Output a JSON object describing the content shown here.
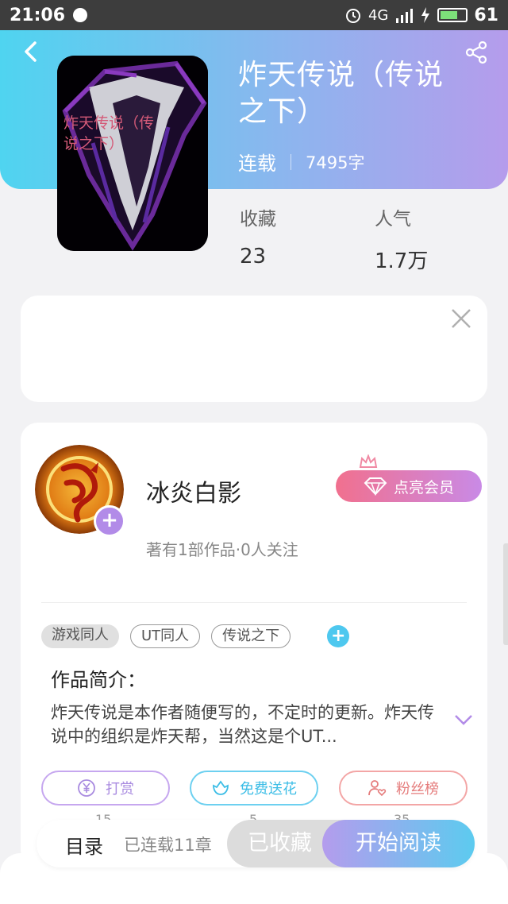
{
  "status_bar": {
    "time": "21:06",
    "network": "4G",
    "battery": "61"
  },
  "book": {
    "title": "炸天传说（传说之下）",
    "status": "连载",
    "word_count": "7495字",
    "cover_text": "炸天传说（传说之下）"
  },
  "stats": [
    {
      "label": "收藏",
      "value": "23"
    },
    {
      "label": "人气",
      "value": "1.7万"
    }
  ],
  "author": {
    "name": "冰炎白影",
    "summary": "著有1部作品·0人关注",
    "vip_label": "点亮会员"
  },
  "tags": [
    "游戏同人",
    "UT同人",
    "传说之下"
  ],
  "intro": {
    "title": "作品简介：",
    "text": "炸天传说是本作者随便写的，不定时的更新。炸天传说中的组织是炸天帮，当然这是个UT..."
  },
  "actions": [
    {
      "label": "打赏",
      "count": "15"
    },
    {
      "label": "免费送花",
      "count": "5"
    },
    {
      "label": "粉丝榜",
      "count": "35"
    }
  ],
  "bottom_bar": {
    "toc_label": "目录",
    "serial_label": "已连载11章",
    "collected_label": "已收藏",
    "read_label": "开始阅读"
  },
  "colors": {
    "header_gradient": [
      "#4fd4f0",
      "#b59cec"
    ],
    "accent_purple": "#b28be8",
    "accent_blue": "#4ec8ef",
    "vip_gradient": [
      "#f1708e",
      "#c98ae6"
    ]
  }
}
